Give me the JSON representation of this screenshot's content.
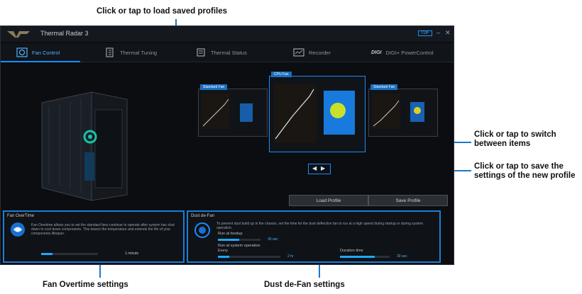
{
  "callouts": {
    "load_profiles": "Click or tap to load saved profiles",
    "switch_items": "Click or tap to switch between items",
    "save_settings": "Click or tap to save the settings of the new profile",
    "fan_overtime": "Fan Overtime settings",
    "dust_defan": "Dust de-Fan settings"
  },
  "app": {
    "title": "Thermal Radar 3",
    "tabs": [
      {
        "label": "Fan Control",
        "icon": "fan-icon",
        "active": true
      },
      {
        "label": "Thermal Tuning",
        "icon": "thermal-tuning-icon",
        "active": false
      },
      {
        "label": "Thermal Status",
        "icon": "thermal-status-icon",
        "active": false
      },
      {
        "label": "Recorder",
        "icon": "recorder-icon",
        "active": false
      },
      {
        "label": "DIGI+ PowerControl",
        "icon": "digi-icon",
        "active": false
      }
    ],
    "profiles": [
      {
        "label": "Standard Fan"
      },
      {
        "label": "CPU Fan"
      },
      {
        "label": "Standard Fan"
      }
    ],
    "buttons": {
      "load": "Load Profile",
      "save": "Save Profile"
    },
    "fan_overtime": {
      "title": "Fan OverTime",
      "description": "Fan Overtime allows you to set the standard fans continue to operate after system has shut down to cool down components. This lowers the temperature and extends the life of your components lifespan.",
      "value": "1 minute",
      "level": 0.2
    },
    "dust_defan": {
      "title": "Dust de-Fan",
      "description": "To prevent dust build up in the chassis, set the time for the dust deflection fan to run at a high speed during startup or during system operation.",
      "boot_label": "Run at bootup",
      "boot_value": "30 sec",
      "boot_level": 0.5,
      "operation_label": "Run at system operation",
      "every_label": "Every",
      "every_value": "2 hr",
      "every_level": 0.18,
      "duration_label": "Duration time",
      "duration_value": "30 sec",
      "duration_level": 0.7
    }
  },
  "colors": {
    "accent": "#1a8cff",
    "callout_line": "#1b78c8",
    "app_bg": "#0b0d10"
  }
}
